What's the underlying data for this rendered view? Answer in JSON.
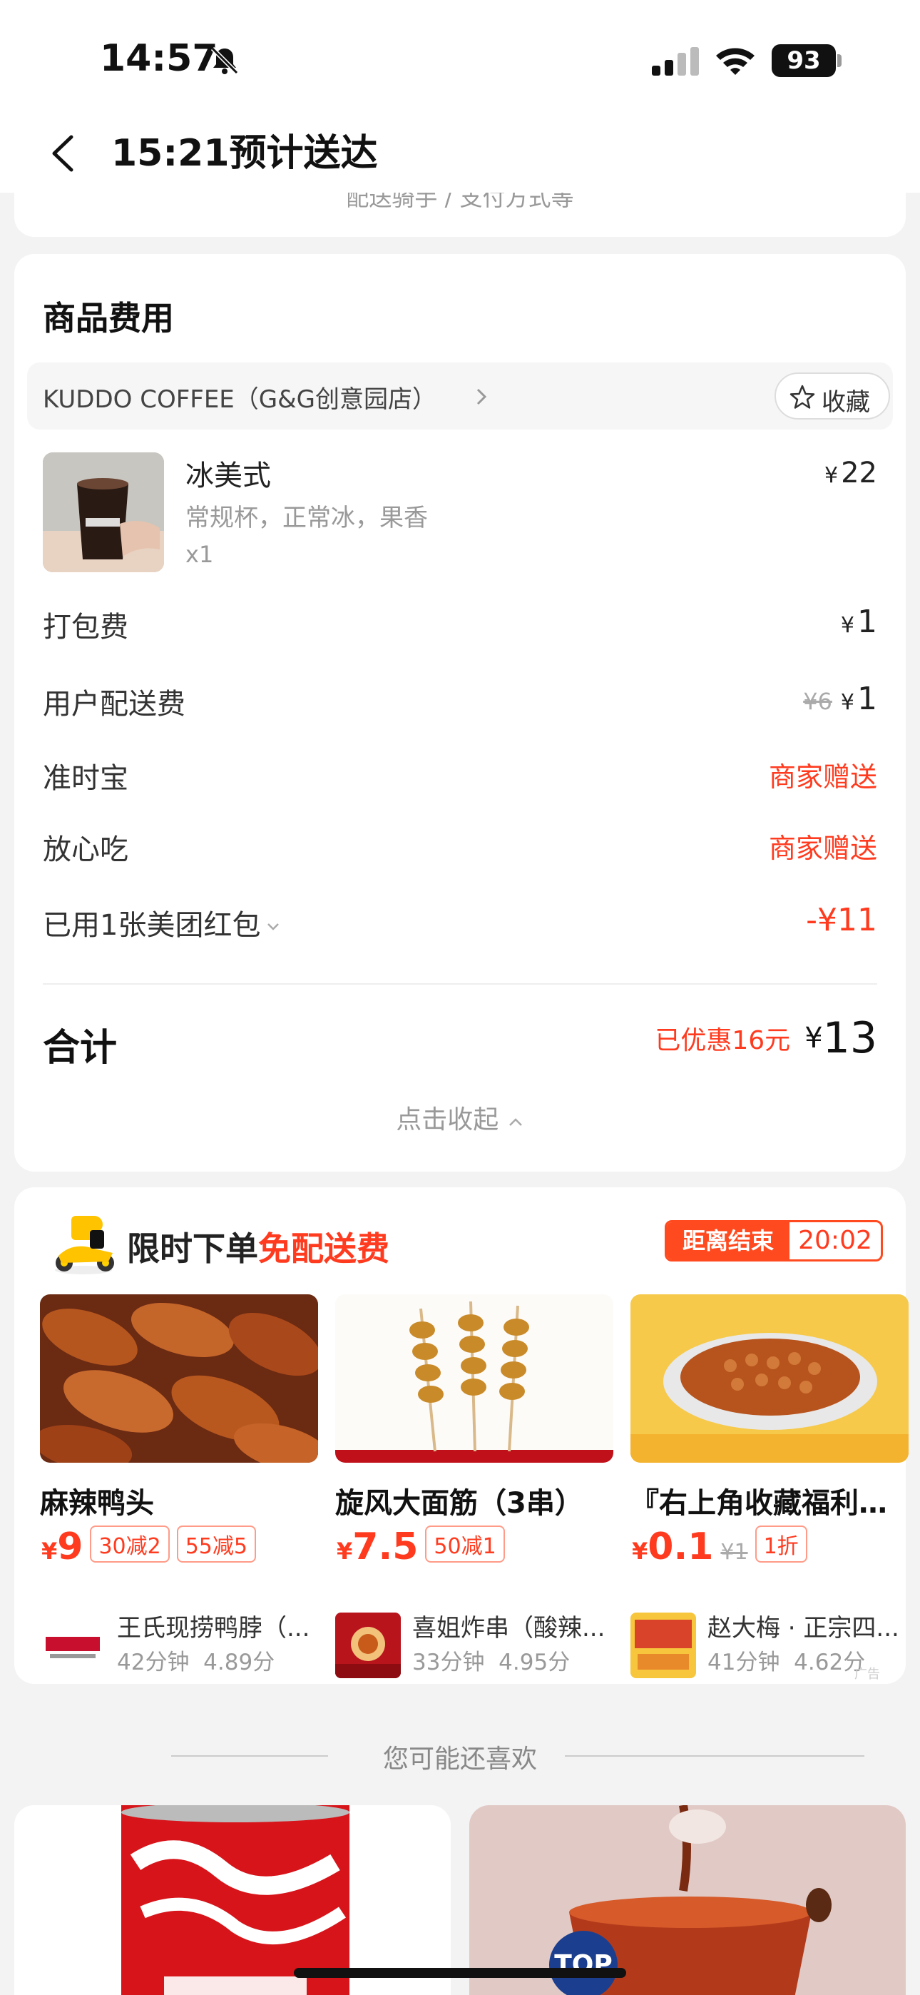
{
  "status_bar": {
    "time": "14:57",
    "battery": "93"
  },
  "header": {
    "title": "15:21预计送达"
  },
  "previous_card_tail": "配送骑手 / 支付方式等",
  "fee_card": {
    "title": "商品费用",
    "store_name": "KUDDO COFFEE（G&G创意园店）",
    "favorite_label": "收藏",
    "product": {
      "name": "冰美式",
      "spec": "常规杯，正常冰，果香",
      "qty": "x1",
      "price_symbol": "¥",
      "price": "22"
    },
    "rows": [
      {
        "label": "打包费",
        "symbol": "¥",
        "value": "1"
      },
      {
        "label": "用户配送费",
        "original": "¥6",
        "symbol": "¥",
        "value": "1"
      },
      {
        "label": "准时宝",
        "value_text": "商家赠送"
      },
      {
        "label": "放心吃",
        "value_text": "商家赠送"
      },
      {
        "label": "已用1张美团红包",
        "discount": "-¥11"
      }
    ],
    "total_label": "合计",
    "saved_text": "已优惠16元",
    "total_symbol": "¥",
    "total_value": "13",
    "collapse_text": "点击收起"
  },
  "promo": {
    "title_prefix": "限时下单",
    "title_highlight": "免配送费",
    "countdown_label": "距离结束",
    "countdown_time": "20:02",
    "ad_label": "广告",
    "items": [
      {
        "name": "麻辣鸭头",
        "symbol": "¥",
        "price": "9",
        "old_price": "",
        "tags": [
          "30减2",
          "55减5"
        ],
        "store": "王氏现捞鸭脖（...",
        "time": "42分钟",
        "score": "4.89分"
      },
      {
        "name": "旋风大面筋（3串）",
        "symbol": "¥",
        "price": "7.5",
        "old_price": "",
        "tags": [
          "50减1"
        ],
        "store": "喜姐炸串（酸辣...",
        "time": "33分钟",
        "score": "4.95分"
      },
      {
        "name": "『右上角收藏福利』...",
        "symbol": "¥",
        "price": "0.1",
        "old_price": "¥1",
        "tags": [
          "1折"
        ],
        "store": "赵大梅 · 正宗四...",
        "time": "41分钟",
        "score": "4.62分"
      }
    ]
  },
  "recommend": {
    "title": "您可能还喜欢",
    "top_button": "TOP"
  },
  "colors": {
    "accent": "#ff3b1f",
    "countdown": "#ff4a1f",
    "top_button": "#1b3e8f"
  }
}
